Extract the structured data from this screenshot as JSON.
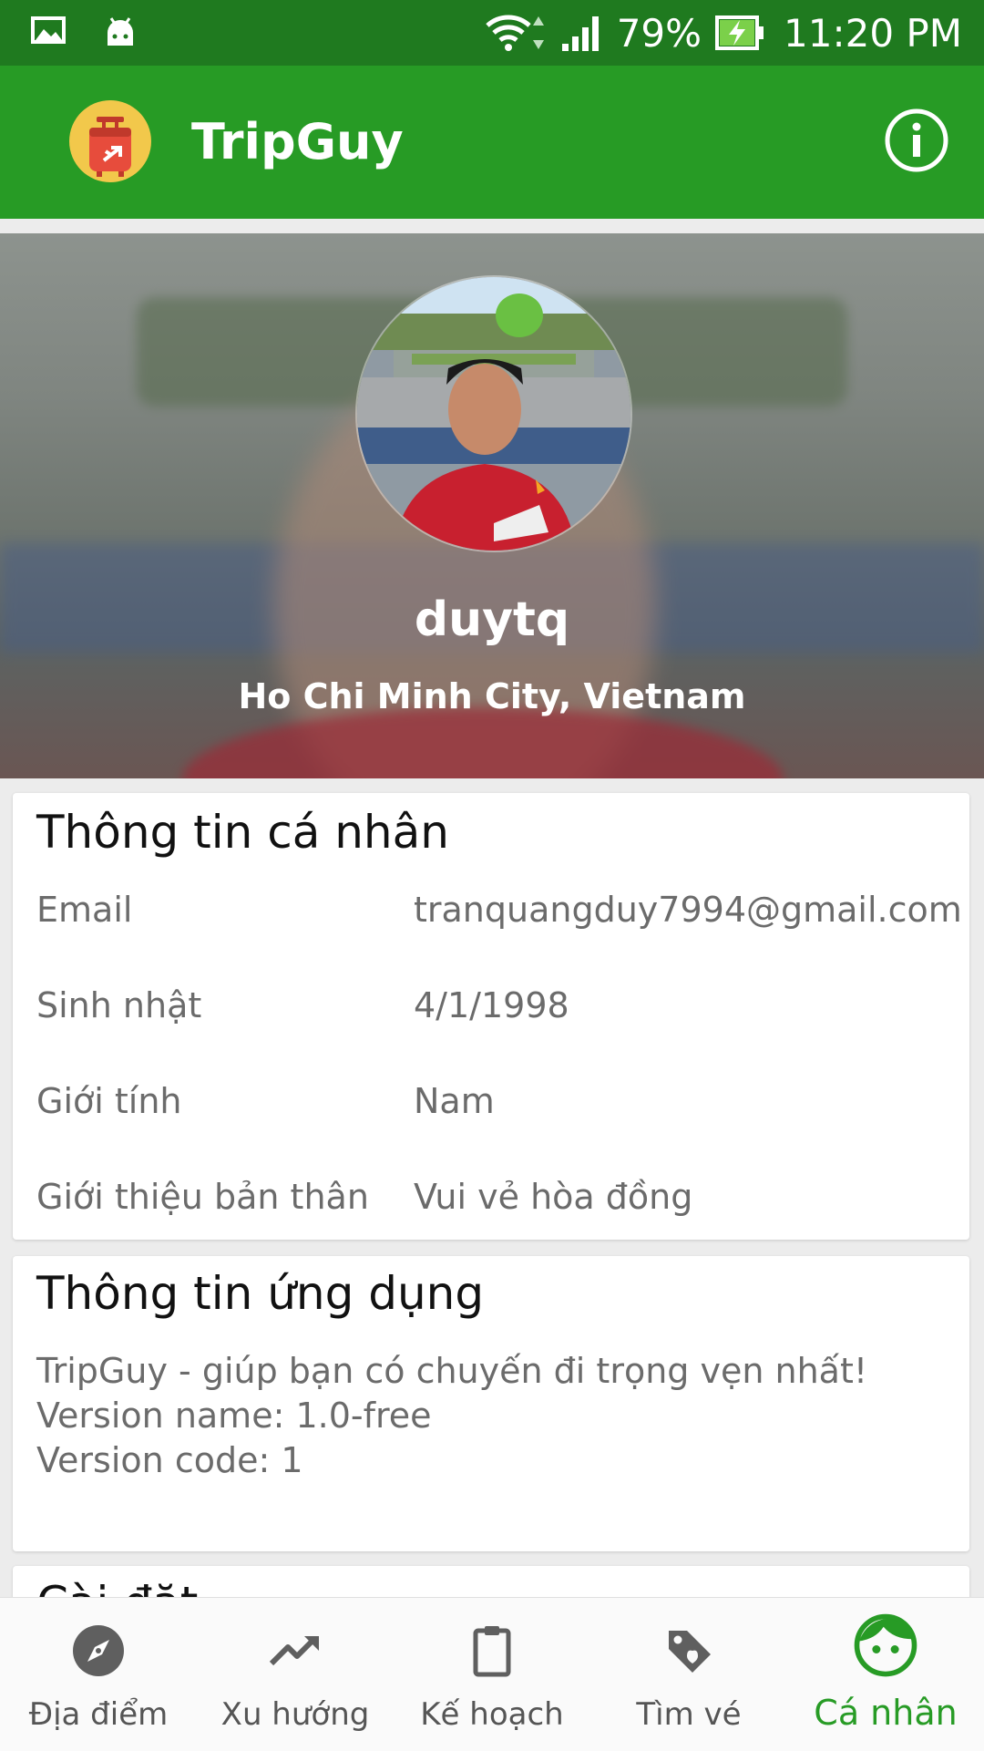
{
  "status_bar": {
    "battery": "79%",
    "time": "11:20 PM"
  },
  "app_bar": {
    "title": "TripGuy"
  },
  "profile": {
    "username": "duytq",
    "location": "Ho Chi Minh City, Vietnam"
  },
  "personal_info": {
    "title": "Thông tin cá nhân",
    "rows": [
      {
        "label": "Email",
        "value": "tranquangduy7994@gmail.com"
      },
      {
        "label": "Sinh nhật",
        "value": "4/1/1998"
      },
      {
        "label": "Giới tính",
        "value": "Nam"
      },
      {
        "label": "Giới thiệu bản thân",
        "value": "Vui vẻ hòa đồng"
      }
    ]
  },
  "app_info": {
    "title": "Thông tin ứng dụng",
    "lines": [
      "TripGuy - giúp bạn có chuyến đi trọng vẹn nhất!",
      "Version name: 1.0-free",
      "Version code: 1"
    ]
  },
  "settings": {
    "title": "Cài đặt"
  },
  "bottom_nav": {
    "items": [
      {
        "label": "Địa điểm",
        "icon": "compass-icon"
      },
      {
        "label": "Xu hướng",
        "icon": "trending-up-icon"
      },
      {
        "label": "Kế hoạch",
        "icon": "clipboard-icon"
      },
      {
        "label": "Tìm vé",
        "icon": "tag-icon"
      },
      {
        "label": "Cá nhân",
        "icon": "face-icon"
      }
    ],
    "active_index": 4
  },
  "colors": {
    "status_bar": "#1f7a1f",
    "app_bar": "#279b25",
    "accent": "#279b25",
    "nav_inactive": "#555555"
  }
}
